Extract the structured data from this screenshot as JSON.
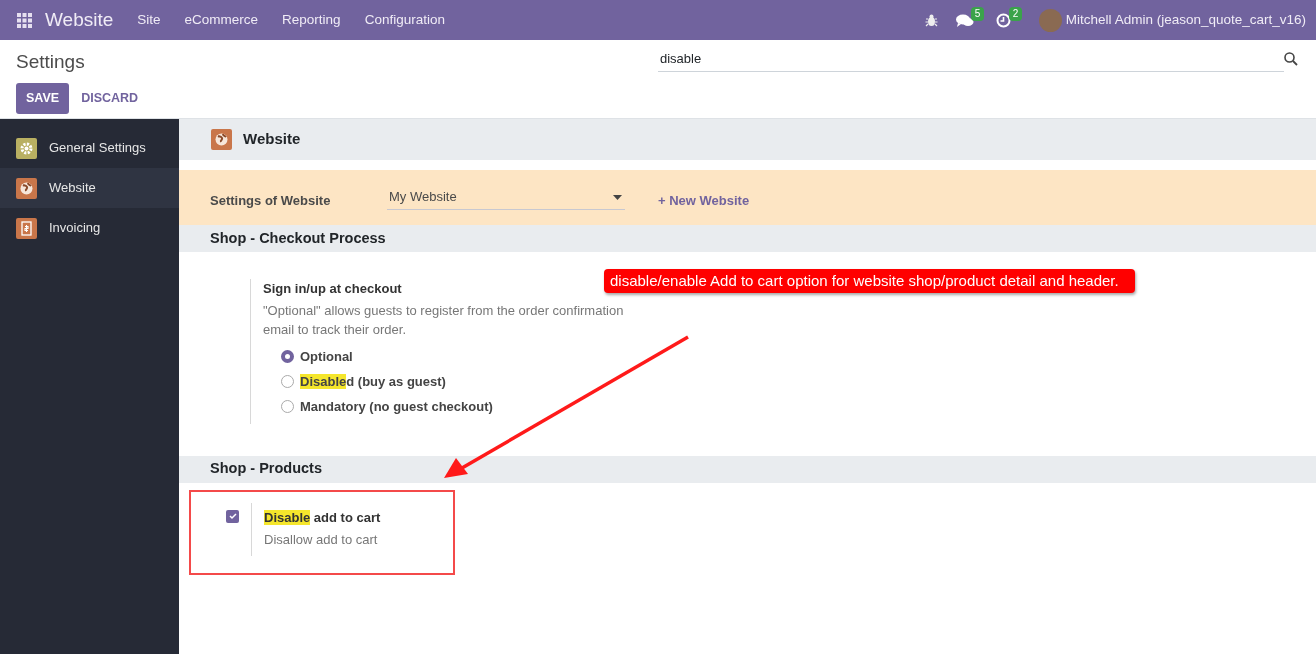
{
  "navbar": {
    "app_name": "Website",
    "menu": [
      "Site",
      "eCommerce",
      "Reporting",
      "Configuration"
    ],
    "messages_count": "5",
    "activities_count": "2",
    "user": "Mitchell Admin (jeason_quote_cart_v16)"
  },
  "control_panel": {
    "title": "Settings",
    "search_value": "disable",
    "buttons": [
      {
        "label": "SAVE",
        "kind": "primary"
      },
      {
        "label": "DISCARD",
        "kind": "link"
      }
    ]
  },
  "sidebar": {
    "items": [
      {
        "label": "General Settings",
        "selected": false
      },
      {
        "label": "Website",
        "selected": true
      },
      {
        "label": "Invoicing",
        "selected": false
      }
    ]
  },
  "app_header": "Website",
  "website_selector": {
    "label": "Settings of Website",
    "value": "My Website",
    "new_link": "+ New Website"
  },
  "sections": [
    {
      "title": "Shop - Checkout Process",
      "settings": [
        {
          "kind": "radio",
          "title": "Sign in/up at checkout",
          "description": "\"Optional\" allows guests to register from the order confirmation email to track their order.",
          "options": [
            {
              "parts": [
                {
                  "text": "Optional",
                  "highlighted": false
                }
              ],
              "selected": true
            },
            {
              "parts": [
                {
                  "text": "Disable",
                  "highlighted": true
                },
                {
                  "text": "d (buy as guest)",
                  "highlighted": false
                }
              ],
              "selected": false
            },
            {
              "parts": [
                {
                  "text": "Mandatory (no guest checkout)",
                  "highlighted": false
                }
              ],
              "selected": false
            }
          ]
        }
      ]
    },
    {
      "title": "Shop - Products",
      "settings": [
        {
          "kind": "checkbox",
          "title_parts": [
            {
              "text": "Disable",
              "highlighted": true
            },
            {
              "text": " add to cart",
              "highlighted": false
            }
          ],
          "description": "Disallow add to cart",
          "checked": true
        }
      ]
    }
  ],
  "annotation": {
    "text": "disable/enable Add to cart option for website shop/product detail and header."
  }
}
